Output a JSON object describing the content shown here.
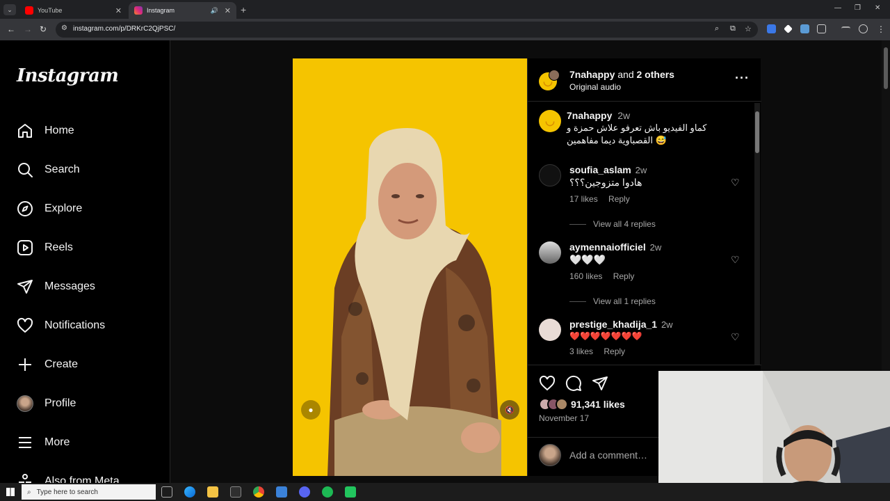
{
  "browser": {
    "tabs": [
      {
        "label": "YouTube",
        "active": false
      },
      {
        "label": "Instagram",
        "active": true
      }
    ],
    "url": "instagram.com/p/DRKrC2QjPSC/"
  },
  "sidebar": {
    "logo": "Instagram",
    "items": [
      {
        "label": "Home",
        "icon": "home-icon"
      },
      {
        "label": "Search",
        "icon": "search-icon"
      },
      {
        "label": "Explore",
        "icon": "compass-icon"
      },
      {
        "label": "Reels",
        "icon": "reels-icon"
      },
      {
        "label": "Messages",
        "icon": "send-icon"
      },
      {
        "label": "Notifications",
        "icon": "heart-icon"
      },
      {
        "label": "Create",
        "icon": "plus-icon"
      },
      {
        "label": "Profile",
        "icon": "profile-avatar"
      },
      {
        "label": "More",
        "icon": "menu-icon"
      },
      {
        "label": "Also from Meta",
        "icon": "meta-icon"
      }
    ]
  },
  "post": {
    "header": {
      "user": "7nahappy",
      "and_others": " and ",
      "others": "2 others",
      "audio": "Original audio"
    },
    "caption": {
      "user": "7nahappy",
      "time": "2w",
      "line1": "كماو الفيديو باش تعرفو علاش حمزة و",
      "line2": "القصباوية ديما مفاهمين 😅"
    },
    "comments": [
      {
        "user": "soufia_aslam",
        "time": "2w",
        "text": "هادوا متزوجين؟؟؟",
        "likes": "17 likes",
        "reply": "Reply",
        "view_replies": "View all 4 replies"
      },
      {
        "user": "aymennaiofficiel",
        "time": "2w",
        "text": "🤍🤍🤍",
        "likes": "160 likes",
        "reply": "Reply",
        "view_replies": "View all 1 replies"
      },
      {
        "user": "prestige_khadija_1",
        "time": "2w",
        "text": "❤️❤️❤️❤️❤️❤️❤️",
        "likes": "3 likes",
        "reply": "Reply"
      }
    ],
    "likes_count": "91,341 likes",
    "date": "November 17",
    "add_comment_placeholder": "Add a comment…"
  },
  "taskbar": {
    "search_placeholder": "Type here to search"
  },
  "colors": {
    "video_bg": "#f5c400",
    "accent": "#f5f5f5"
  }
}
